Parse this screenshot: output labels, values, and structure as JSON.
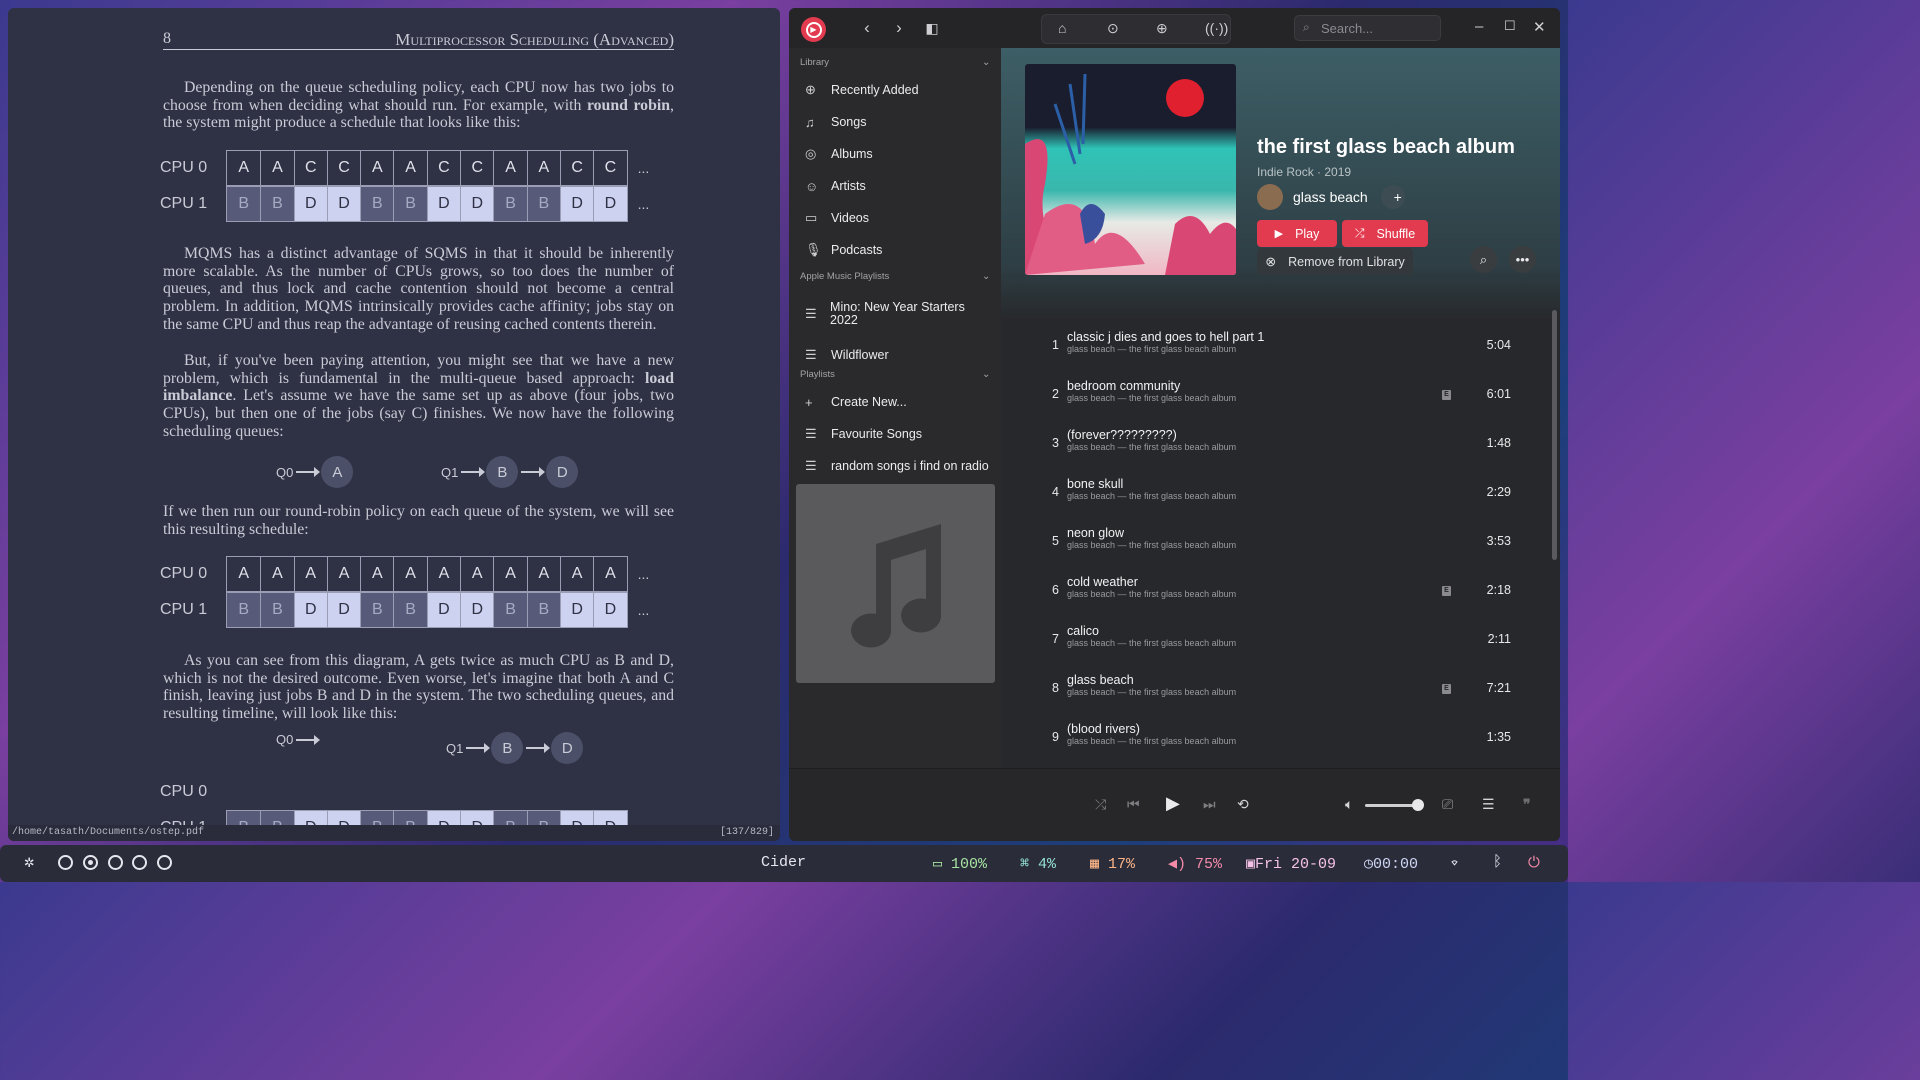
{
  "pdf": {
    "page_number": "8",
    "chapter_title": "Multiprocessor Scheduling (Advanced)",
    "para1_a": "Depending on the queue scheduling policy, each CPU now has two jobs to choose from when deciding what should run. For example, with ",
    "para1_bold": "round robin",
    "para1_b": ", the system might produce a schedule that looks like this:",
    "cpu0_label": "CPU 0",
    "cpu1_label": "CPU 1",
    "ellipsis": "...",
    "schedule1_cpu0": [
      "A",
      "A",
      "C",
      "C",
      "A",
      "A",
      "C",
      "C",
      "A",
      "A",
      "C",
      "C"
    ],
    "schedule1_cpu1": [
      "B",
      "B",
      "D",
      "D",
      "B",
      "B",
      "D",
      "D",
      "B",
      "B",
      "D",
      "D"
    ],
    "para2": "MQMS has a distinct advantage of SQMS in that it should be inherently more scalable. As the number of CPUs grows, so too does the number of queues, and thus lock and cache contention should not become a central problem. In addition, MQMS intrinsically provides cache affinity; jobs stay on the same CPU and thus reap the advantage of reusing cached contents therein.",
    "para3_a": "But, if you've been paying attention, you might see that we have a new problem, which is fundamental in the multi-queue based approach: ",
    "para3_bold": "load imbalance",
    "para3_b": ". Let's assume we have the same set up as above (four jobs, two CPUs), but then one of the jobs (say C) finishes. We now have the following scheduling queues:",
    "q0_label": "Q0",
    "q1_label": "Q1",
    "queue1_q0": [
      "A"
    ],
    "queue1_q1": [
      "B",
      "D"
    ],
    "para4": "If we then run our round-robin policy on each queue of the system, we will see this resulting schedule:",
    "schedule2_cpu0": [
      "A",
      "A",
      "A",
      "A",
      "A",
      "A",
      "A",
      "A",
      "A",
      "A",
      "A",
      "A"
    ],
    "schedule2_cpu1": [
      "B",
      "B",
      "D",
      "D",
      "B",
      "B",
      "D",
      "D",
      "B",
      "B",
      "D",
      "D"
    ],
    "para5": "As you can see from this diagram, A gets twice as much CPU as B and D, which is not the desired outcome. Even worse, let's imagine that both A and C finish, leaving just jobs B and D in the system. The two scheduling queues, and resulting timeline, will look like this:",
    "queue2_q1": [
      "B",
      "D"
    ],
    "file_path": "/home/tasath/Documents/ostep.pdf",
    "page_indicator": "[137/829]"
  },
  "cider": {
    "search_placeholder": "Search...",
    "sidebar": {
      "library_header": "Library",
      "library_items": [
        {
          "label": "Recently Added",
          "icon": "plus-circle-icon"
        },
        {
          "label": "Songs",
          "icon": "music-note-icon"
        },
        {
          "label": "Albums",
          "icon": "disc-icon"
        },
        {
          "label": "Artists",
          "icon": "person-icon"
        },
        {
          "label": "Videos",
          "icon": "video-icon"
        },
        {
          "label": "Podcasts",
          "icon": "microphone-icon"
        }
      ],
      "apple_header": "Apple Music Playlists",
      "apple_items": [
        "Mino: New Year Starters 2022",
        "Wildflower"
      ],
      "playlists_header": "Playlists",
      "create_label": "Create New...",
      "playlist_items": [
        "Favourite Songs",
        "random songs i find on radio"
      ]
    },
    "album": {
      "title": "the first glass beach album",
      "genre_year": "Indie Rock · 2019",
      "artist": "glass beach",
      "play_label": "Play",
      "shuffle_label": "Shuffle",
      "remove_label": "Remove from Library"
    },
    "tracks": [
      {
        "n": "1",
        "name": "classic j dies and goes to hell part 1",
        "sub": "glass beach — the first glass beach album",
        "dur": "5:04",
        "explicit": false
      },
      {
        "n": "2",
        "name": "bedroom community",
        "sub": "glass beach — the first glass beach album",
        "dur": "6:01",
        "explicit": true
      },
      {
        "n": "3",
        "name": "(forever?????????)",
        "sub": "glass beach — the first glass beach album",
        "dur": "1:48",
        "explicit": false
      },
      {
        "n": "4",
        "name": "bone skull",
        "sub": "glass beach — the first glass beach album",
        "dur": "2:29",
        "explicit": false
      },
      {
        "n": "5",
        "name": "neon glow",
        "sub": "glass beach — the first glass beach album",
        "dur": "3:53",
        "explicit": false
      },
      {
        "n": "6",
        "name": "cold weather",
        "sub": "glass beach — the first glass beach album",
        "dur": "2:18",
        "explicit": true
      },
      {
        "n": "7",
        "name": "calico",
        "sub": "glass beach — the first glass beach album",
        "dur": "2:11",
        "explicit": false
      },
      {
        "n": "8",
        "name": "glass beach",
        "sub": "glass beach — the first glass beach album",
        "dur": "7:21",
        "explicit": true
      },
      {
        "n": "9",
        "name": "(blood rivers)",
        "sub": "glass beach — the first glass beach album",
        "dur": "1:35",
        "explicit": false
      }
    ],
    "explicit_badge": "E",
    "volume_level": 0.9
  },
  "taskbar": {
    "window_title": "Cider",
    "battery": "100%",
    "cpu": "4%",
    "memory": "17%",
    "volume": "75%",
    "date": "Fri 20-09",
    "time": "00:00",
    "colors": {
      "battery": "#a6e3a1",
      "cpu": "#94e2d5",
      "memory": "#fab387",
      "volume": "#f38ba8",
      "date": "#f5c2e7",
      "time": "#cdd6f4",
      "power": "#f38ba8"
    }
  }
}
